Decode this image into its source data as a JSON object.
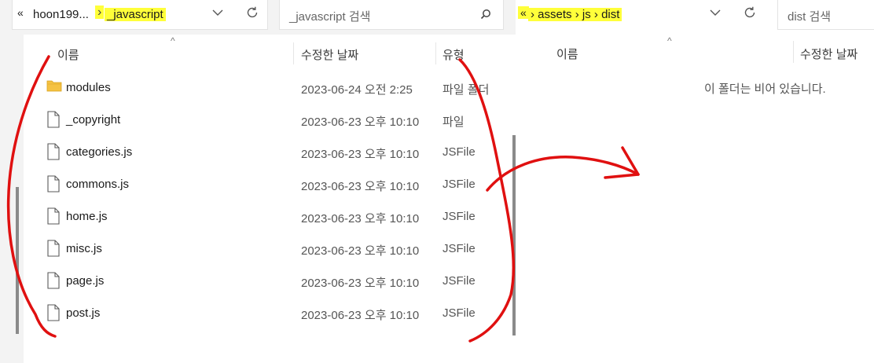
{
  "left": {
    "breadcrumb": {
      "overflow": "«",
      "parent": "hoon199...",
      "current": "_javascript"
    },
    "search": {
      "placeholder": "_javascript 검색"
    },
    "columns": {
      "name": "이름",
      "modified": "수정한 날짜",
      "type": "유형"
    },
    "rows": [
      {
        "name": "modules",
        "date": "2023-06-24 오전 2:25",
        "type": "파일 폴더",
        "icon": "folder-icon"
      },
      {
        "name": "_copyright",
        "date": "2023-06-23 오후 10:10",
        "type": "파일",
        "icon": "file-icon"
      },
      {
        "name": "categories.js",
        "date": "2023-06-23 오후 10:10",
        "type": "JSFile",
        "icon": "file-icon"
      },
      {
        "name": "commons.js",
        "date": "2023-06-23 오후 10:10",
        "type": "JSFile",
        "icon": "file-icon"
      },
      {
        "name": "home.js",
        "date": "2023-06-23 오후 10:10",
        "type": "JSFile",
        "icon": "file-icon"
      },
      {
        "name": "misc.js",
        "date": "2023-06-23 오후 10:10",
        "type": "JSFile",
        "icon": "file-icon"
      },
      {
        "name": "page.js",
        "date": "2023-06-23 오후 10:10",
        "type": "JSFile",
        "icon": "file-icon"
      },
      {
        "name": "post.js",
        "date": "2023-06-23 오후 10:10",
        "type": "JSFile",
        "icon": "file-icon"
      }
    ]
  },
  "right": {
    "breadcrumb": {
      "overflow": "«",
      "items": [
        "assets",
        "js",
        "dist"
      ]
    },
    "search": {
      "placeholder": "dist 검색"
    },
    "columns": {
      "name": "이름",
      "modified": "수정한 날짜"
    },
    "empty_message": "이 폴더는 비어 있습니다."
  },
  "colors": {
    "highlight": "#ffff3a",
    "annotation": "#e01010",
    "folder": "#f5c242"
  }
}
